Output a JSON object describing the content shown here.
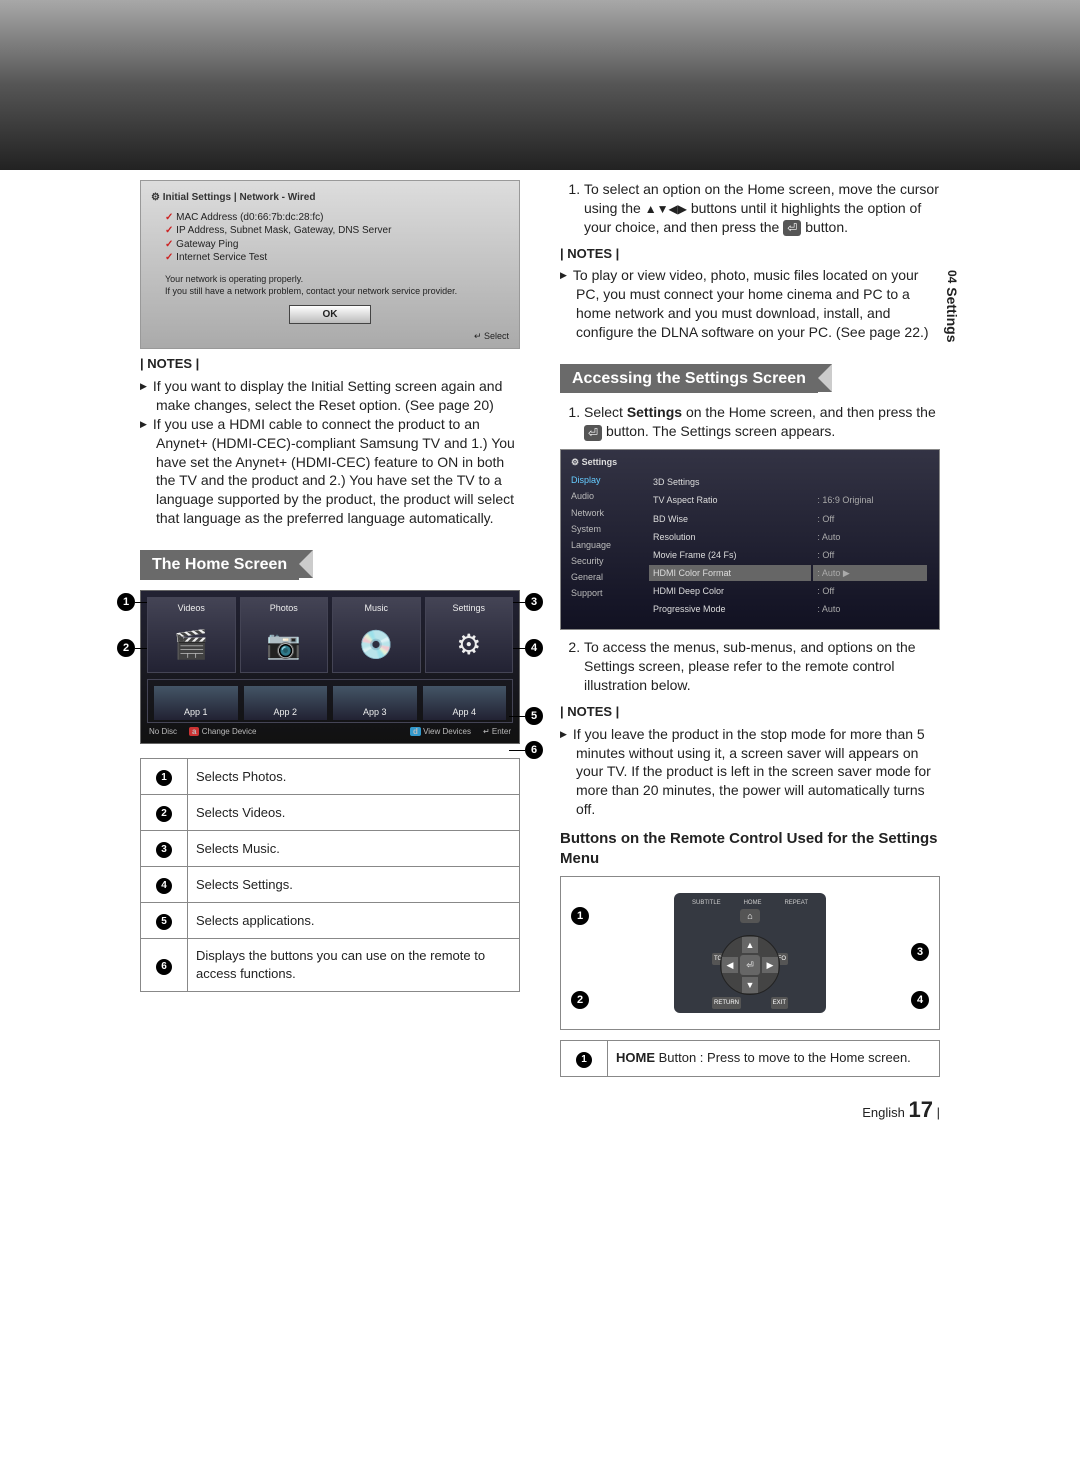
{
  "sideTab": {
    "num": "04",
    "label": "Settings"
  },
  "dialog": {
    "title": "Initial Settings | Network - Wired",
    "items": [
      "MAC Address (d0:66:7b:dc:28:fc)",
      "IP Address, Subnet Mask, Gateway, DNS Server",
      "Gateway Ping",
      "Internet Service Test"
    ],
    "noteLine1": "Your network is operating properly.",
    "noteLine2": "If you still have a network problem, contact your network service provider.",
    "ok": "OK",
    "footer": "↵ Select"
  },
  "leftNotesHeader": "| NOTES |",
  "leftNotes": [
    "If you want to display the Initial Setting screen again and make changes, select the Reset option. (See page 20)",
    "If you use a HDMI cable to connect the product to an Anynet+ (HDMI-CEC)-compliant Samsung TV and 1.) You have set the Anynet+ (HDMI-CEC) feature to ON in both the TV and the product and 2.) You have set the TV to a language supported by the product, the product will select that language as the preferred language automatically."
  ],
  "homeHeader": "The Home Screen",
  "homeTabs": [
    "Videos",
    "Photos",
    "Music",
    "Settings"
  ],
  "homeApps": [
    "App 1",
    "App 2",
    "App 3",
    "App 4"
  ],
  "homeBarNoDisc": "No Disc",
  "homeBarA": "a",
  "homeBarALabel": "Change Device",
  "homeBarD": "d",
  "homeBarDLabel": "View Devices",
  "homeBarEnter": "↵ Enter",
  "legend": [
    {
      "n": "1",
      "t": "Selects Photos."
    },
    {
      "n": "2",
      "t": "Selects Videos."
    },
    {
      "n": "3",
      "t": "Selects Music."
    },
    {
      "n": "4",
      "t": "Selects Settings."
    },
    {
      "n": "5",
      "t": "Selects applications."
    },
    {
      "n": "6",
      "t": "Displays the buttons you can use on the remote to access functions."
    }
  ],
  "rightStep1a": "To select an option on the Home screen, move the cursor using the ",
  "rightStep1b": " buttons until it highlights the option of your choice, and then press the ",
  "rightStep1c": " button.",
  "rightNotesHeader1": "| NOTES |",
  "rightNote1": "To play or view video, photo, music files located on your PC, you must connect your home cinema and PC to a home network and you must download, install, and configure the DLNA software on your PC. (See page 22.)",
  "accessingHeader": "Accessing the Settings Screen",
  "accessStep1a": "Select ",
  "accessStep1bold": "Settings",
  "accessStep1b": " on the Home screen, and then press the ",
  "accessStep1c": " button. The Settings screen appears.",
  "settingsPanel": {
    "title": "Settings",
    "menu": [
      "Display",
      "Audio",
      "Network",
      "System",
      "Language",
      "Security",
      "General",
      "Support"
    ],
    "rows": [
      {
        "l": "3D Settings",
        "v": ""
      },
      {
        "l": "TV Aspect Ratio",
        "v": ": 16:9 Original"
      },
      {
        "l": "BD Wise",
        "v": ": Off"
      },
      {
        "l": "Resolution",
        "v": ": Auto"
      },
      {
        "l": "Movie Frame (24 Fs)",
        "v": ": Off"
      },
      {
        "l": "HDMI Color Format",
        "v": ": Auto"
      },
      {
        "l": "HDMI Deep Color",
        "v": ": Off"
      },
      {
        "l": "Progressive Mode",
        "v": ": Auto"
      }
    ]
  },
  "accessStep2": "To access the menus, sub-menus, and options on the Settings screen, please refer to the remote control illustration below.",
  "rightNotesHeader2": "| NOTES |",
  "rightNote2": "If you leave the product in the stop mode for more than 5 minutes without using it, a screen saver will appears on your TV. If the product is left in the screen saver mode for more than 20 minutes, the power will automatically turns off.",
  "remoteHeader": "Buttons on the Remote Control Used for the Settings Menu",
  "remoteLabels": {
    "subtitle": "SUBTITLE",
    "home": "HOME",
    "repeat": "REPEAT",
    "tools": "TOOLS",
    "info": "INFO",
    "return": "RETURN",
    "exit": "EXIT"
  },
  "remoteLegend": {
    "n": "1",
    "pre": "HOME",
    "t": " Button : Press to move to the Home screen."
  },
  "arrowsGlyph": "▲▼◀▶",
  "enterGlyph": "⏎",
  "markers": {
    "m1": "1",
    "m2": "2",
    "m3": "3",
    "m4": "4",
    "m5": "5",
    "m6": "6"
  },
  "footerLang": "English",
  "footerPage": "17"
}
